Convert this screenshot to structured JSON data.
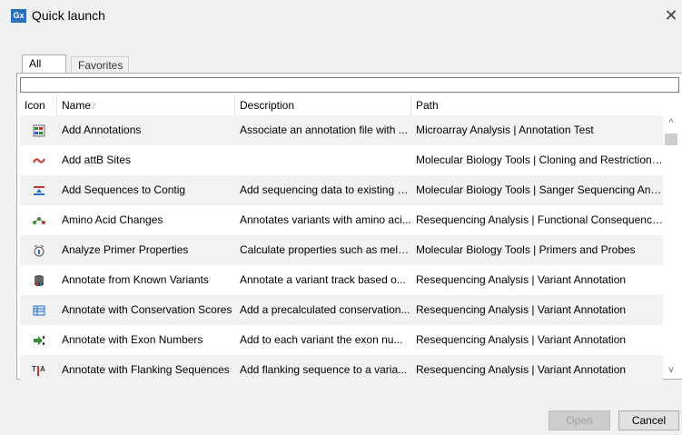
{
  "window": {
    "logo": "Gx",
    "title": "Quick launch",
    "close": "✕"
  },
  "tabs": [
    {
      "label": "All Tools",
      "active": true
    },
    {
      "label": "Favorites",
      "active": false
    }
  ],
  "search": {
    "value": "",
    "placeholder": ""
  },
  "table": {
    "columns": [
      "Icon",
      "Name",
      "Description",
      "Path"
    ],
    "sort_indicator": "⁄",
    "rows": [
      {
        "icon": "annotation-grid-icon",
        "name": "Add Annotations",
        "description": "Associate an annotation file with ...",
        "path": "Microarray Analysis | Annotation Test"
      },
      {
        "icon": "wave-red-icon",
        "name": "Add attB Sites",
        "description": "",
        "path": "Molecular Biology Tools | Cloning and Restriction ..."
      },
      {
        "icon": "contig-add-icon",
        "name": "Add Sequences to Contig",
        "description": "Add sequencing data to existing c...",
        "path": "Molecular Biology Tools | Sanger Sequencing Anal..."
      },
      {
        "icon": "amino-acid-icon",
        "name": "Amino Acid Changes",
        "description": "Annotates variants with amino aci...",
        "path": "Resequencing Analysis | Functional Consequences"
      },
      {
        "icon": "primer-properties-icon",
        "name": "Analyze Primer Properties",
        "description": "Calculate properties such as melti...",
        "path": "Molecular Biology Tools | Primers and Probes"
      },
      {
        "icon": "variant-db-icon",
        "name": "Annotate from Known Variants",
        "description": "Annotate a variant track based o...",
        "path": "Resequencing Analysis | Variant Annotation"
      },
      {
        "icon": "conservation-table-icon",
        "name": "Annotate with Conservation Scores",
        "description": "Add a precalculated conservation...",
        "path": "Resequencing Analysis | Variant Annotation"
      },
      {
        "icon": "exon-number-icon",
        "name": "Annotate with Exon Numbers",
        "description": "Add to each variant the exon nu...",
        "path": "Resequencing Analysis | Variant Annotation"
      },
      {
        "icon": "flanking-seq-icon",
        "name": "Annotate with Flanking Sequences",
        "description": "Add flanking sequence to a varia...",
        "path": "Resequencing Analysis | Variant Annotation"
      }
    ]
  },
  "scrollbar": {
    "up": "^",
    "down": "v"
  },
  "buttons": {
    "open": "Open",
    "cancel": "Cancel"
  }
}
